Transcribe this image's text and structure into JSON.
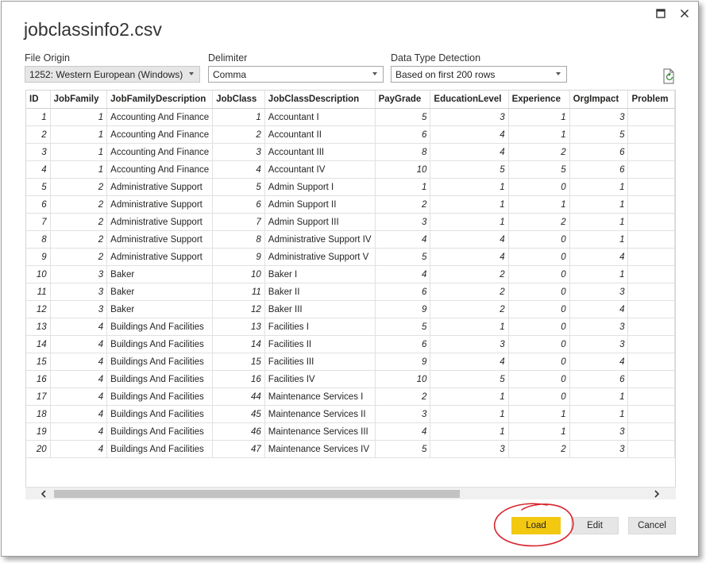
{
  "dialog": {
    "title": "jobclassinfo2.csv"
  },
  "options": {
    "file_origin": {
      "label": "File Origin",
      "value": "1252: Western European (Windows)"
    },
    "delimiter": {
      "label": "Delimiter",
      "value": "Comma"
    },
    "data_type_detection": {
      "label": "Data Type Detection",
      "value": "Based on first 200 rows"
    }
  },
  "table": {
    "columns": [
      "ID",
      "JobFamily",
      "JobFamilyDescription",
      "JobClass",
      "JobClassDescription",
      "PayGrade",
      "EducationLevel",
      "Experience",
      "OrgImpact",
      "Problem"
    ],
    "rows": [
      [
        "1",
        "1",
        "Accounting And Finance",
        "1",
        "Accountant I",
        "5",
        "3",
        "1",
        "3",
        ""
      ],
      [
        "2",
        "1",
        "Accounting And Finance",
        "2",
        "Accountant II",
        "6",
        "4",
        "1",
        "5",
        ""
      ],
      [
        "3",
        "1",
        "Accounting And Finance",
        "3",
        "Accountant III",
        "8",
        "4",
        "2",
        "6",
        ""
      ],
      [
        "4",
        "1",
        "Accounting And Finance",
        "4",
        "Accountant IV",
        "10",
        "5",
        "5",
        "6",
        ""
      ],
      [
        "5",
        "2",
        "Administrative Support",
        "5",
        "Admin Support I",
        "1",
        "1",
        "0",
        "1",
        ""
      ],
      [
        "6",
        "2",
        "Administrative Support",
        "6",
        "Admin Support II",
        "2",
        "1",
        "1",
        "1",
        ""
      ],
      [
        "7",
        "2",
        "Administrative Support",
        "7",
        "Admin Support III",
        "3",
        "1",
        "2",
        "1",
        ""
      ],
      [
        "8",
        "2",
        "Administrative Support",
        "8",
        "Administrative Support IV",
        "4",
        "4",
        "0",
        "1",
        ""
      ],
      [
        "9",
        "2",
        "Administrative Support",
        "9",
        "Administrative Support V",
        "5",
        "4",
        "0",
        "4",
        ""
      ],
      [
        "10",
        "3",
        "Baker",
        "10",
        "Baker I",
        "4",
        "2",
        "0",
        "1",
        ""
      ],
      [
        "11",
        "3",
        "Baker",
        "11",
        "Baker II",
        "6",
        "2",
        "0",
        "3",
        ""
      ],
      [
        "12",
        "3",
        "Baker",
        "12",
        "Baker III",
        "9",
        "2",
        "0",
        "4",
        ""
      ],
      [
        "13",
        "4",
        "Buildings And Facilities",
        "13",
        "Facilities I",
        "5",
        "1",
        "0",
        "3",
        ""
      ],
      [
        "14",
        "4",
        "Buildings And Facilities",
        "14",
        "Facilities II",
        "6",
        "3",
        "0",
        "3",
        ""
      ],
      [
        "15",
        "4",
        "Buildings And Facilities",
        "15",
        "Facilities III",
        "9",
        "4",
        "0",
        "4",
        ""
      ],
      [
        "16",
        "4",
        "Buildings And Facilities",
        "16",
        "Facilities IV",
        "10",
        "5",
        "0",
        "6",
        ""
      ],
      [
        "17",
        "4",
        "Buildings And Facilities",
        "44",
        "Maintenance Services I",
        "2",
        "1",
        "0",
        "1",
        ""
      ],
      [
        "18",
        "4",
        "Buildings And Facilities",
        "45",
        "Maintenance Services II",
        "3",
        "1",
        "1",
        "1",
        ""
      ],
      [
        "19",
        "4",
        "Buildings And Facilities",
        "46",
        "Maintenance Services III",
        "4",
        "1",
        "1",
        "3",
        ""
      ],
      [
        "20",
        "4",
        "Buildings And Facilities",
        "47",
        "Maintenance Services IV",
        "5",
        "3",
        "2",
        "3",
        ""
      ]
    ]
  },
  "buttons": {
    "load": "Load",
    "edit": "Edit",
    "cancel": "Cancel"
  },
  "icons": {
    "maximize": "maximize-icon",
    "close": "close-icon",
    "refresh": "refresh-document-icon"
  },
  "colors": {
    "load_button": "#f2c811",
    "annotation_circle": "#d8242d"
  }
}
